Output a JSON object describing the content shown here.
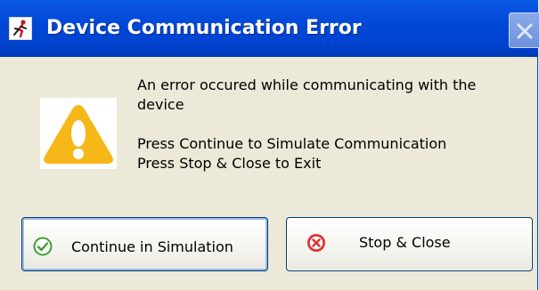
{
  "window": {
    "title": "Device Communication Error"
  },
  "message": {
    "line1": "An error occured while communicating with the device",
    "line2": "Press Continue to Simulate Communication",
    "line3": "Press Stop & Close to Exit"
  },
  "buttons": {
    "continue_label": "Continue in Simulation",
    "stop_label": "Stop & Close"
  },
  "icons": {
    "app": "running-figure-icon",
    "warning": "warning-icon",
    "continue": "check-circle-icon",
    "stop": "error-x-icon",
    "close": "close-icon"
  },
  "colors": {
    "titlebar": "#0047d7",
    "warning": "#f6b818",
    "success": "#3aa12f",
    "error": "#e23131"
  }
}
